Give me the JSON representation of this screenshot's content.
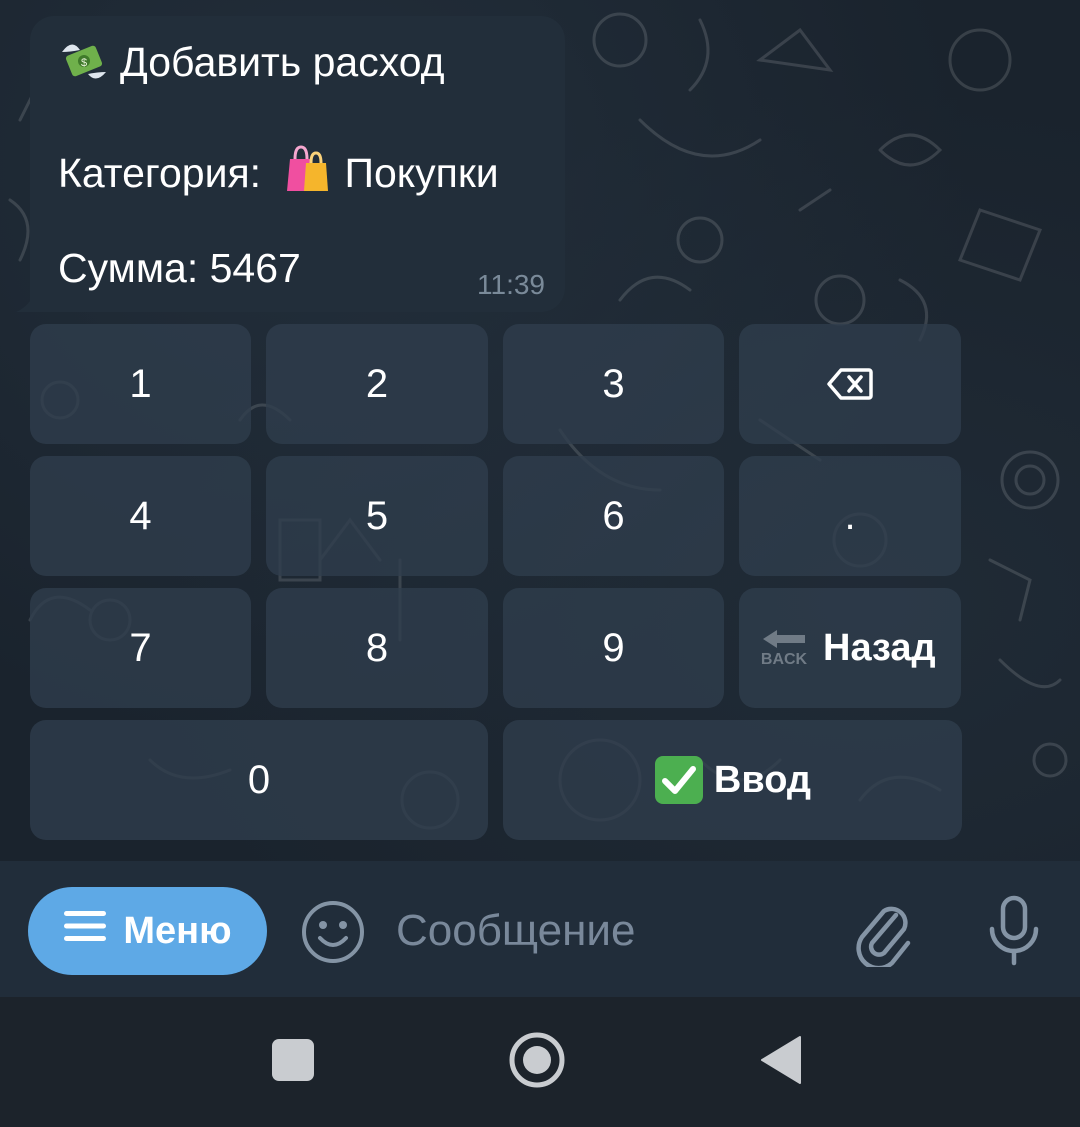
{
  "message": {
    "title": "Добавить расход",
    "title_icon": "money-with-wings-icon",
    "category_label": "Категория:",
    "category_value": "Покупки",
    "category_icon": "shopping-bags-icon",
    "sum_label": "Сумма:",
    "sum_value": "5467",
    "time": "11:39"
  },
  "keyboard": {
    "rows": [
      [
        {
          "label": "1"
        },
        {
          "label": "2"
        },
        {
          "label": "3"
        },
        {
          "label": "",
          "icon": "backspace-icon"
        }
      ],
      [
        {
          "label": "4"
        },
        {
          "label": "5"
        },
        {
          "label": "6"
        },
        {
          "label": "."
        }
      ],
      [
        {
          "label": "7"
        },
        {
          "label": "8"
        },
        {
          "label": "9"
        },
        {
          "label": "Назад",
          "icon": "back-arrow-icon",
          "icon_text": "BACK"
        }
      ],
      [
        {
          "label": "0"
        },
        {
          "label": "Ввод",
          "icon": "check-mark-button-icon"
        }
      ]
    ]
  },
  "input_bar": {
    "menu_label": "Меню",
    "menu_icon": "hamburger-icon",
    "emoji_icon": "smiley-icon",
    "placeholder": "Сообщение",
    "attach_icon": "paperclip-icon",
    "mic_icon": "microphone-icon"
  },
  "nav_bar": {
    "recent_icon": "square-recents-icon",
    "home_icon": "circle-home-icon",
    "back_icon": "triangle-back-icon"
  },
  "colors": {
    "bubble": "#222e3a",
    "key": "#303e4d",
    "menu_button": "#5ea9e6",
    "placeholder": "#79889a",
    "time": "#7a8a99"
  }
}
